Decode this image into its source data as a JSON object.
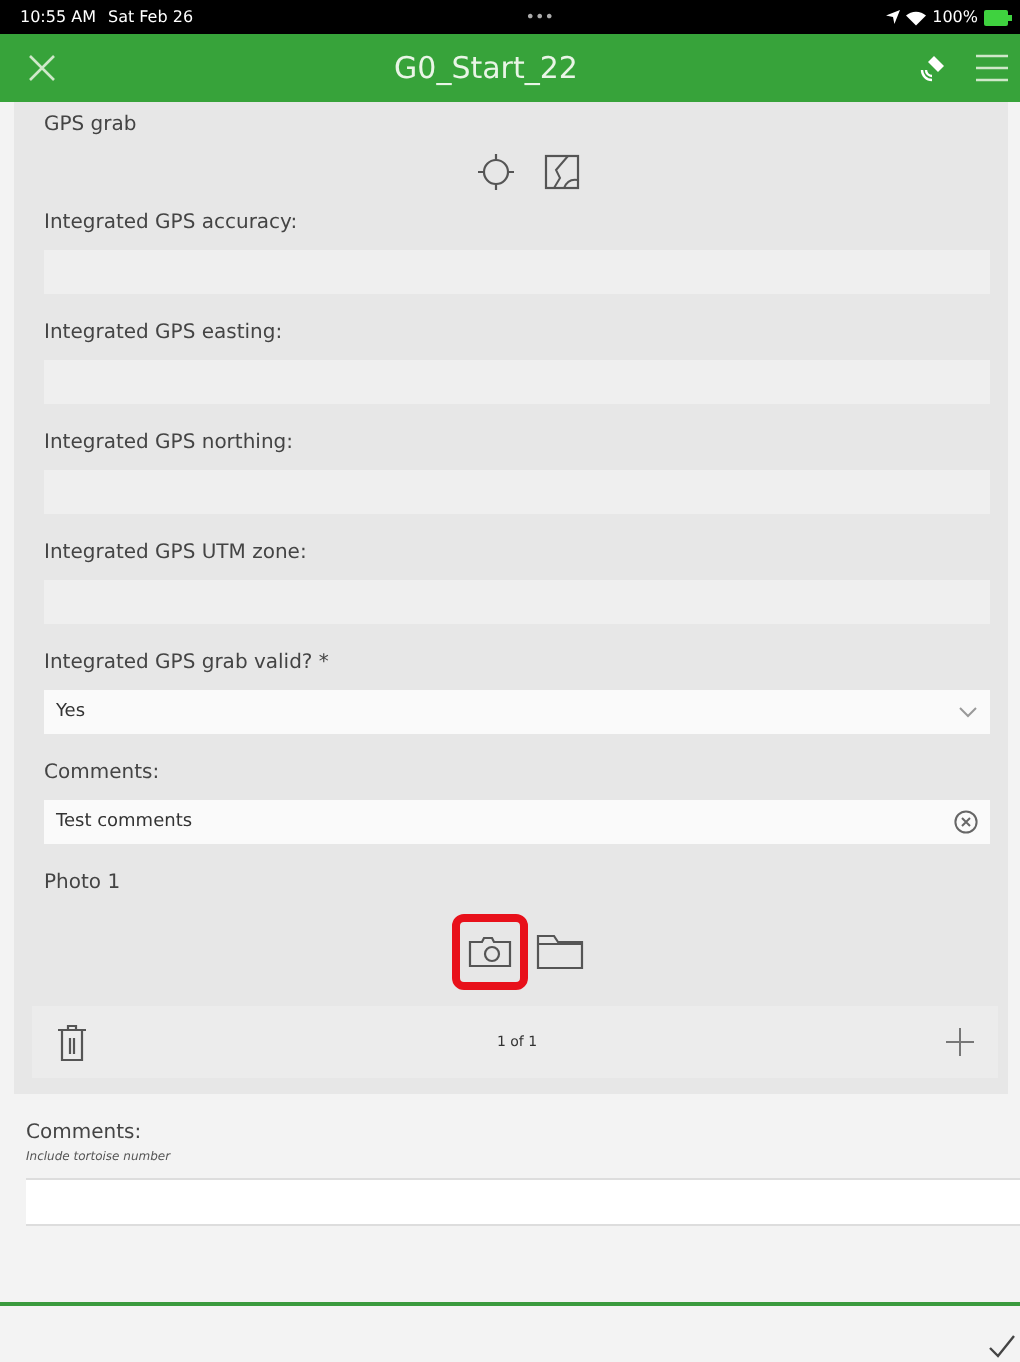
{
  "status_bar": {
    "time": "10:55 AM",
    "date": "Sat Feb 26",
    "dots": "•••",
    "battery": "100%"
  },
  "header": {
    "title": "G0_Start_22"
  },
  "gps_grab": {
    "label": "GPS grab"
  },
  "fields": [
    {
      "kind": "text",
      "label": "Integrated GPS accuracy:"
    },
    {
      "kind": "text",
      "label": "Integrated GPS easting:"
    },
    {
      "kind": "text",
      "label": "Integrated GPS northing:"
    },
    {
      "kind": "text",
      "label": "Integrated GPS UTM zone:"
    },
    {
      "kind": "select",
      "label": "Integrated GPS grab valid? *",
      "value": "Yes"
    },
    {
      "kind": "clearable",
      "label": "Comments:",
      "value": "Test comments"
    }
  ],
  "photo": {
    "label": "Photo 1",
    "camera_highlighted": true,
    "counter": "1 of 1"
  },
  "comments": {
    "label": "Comments:",
    "hint": "Include tortoise number"
  }
}
